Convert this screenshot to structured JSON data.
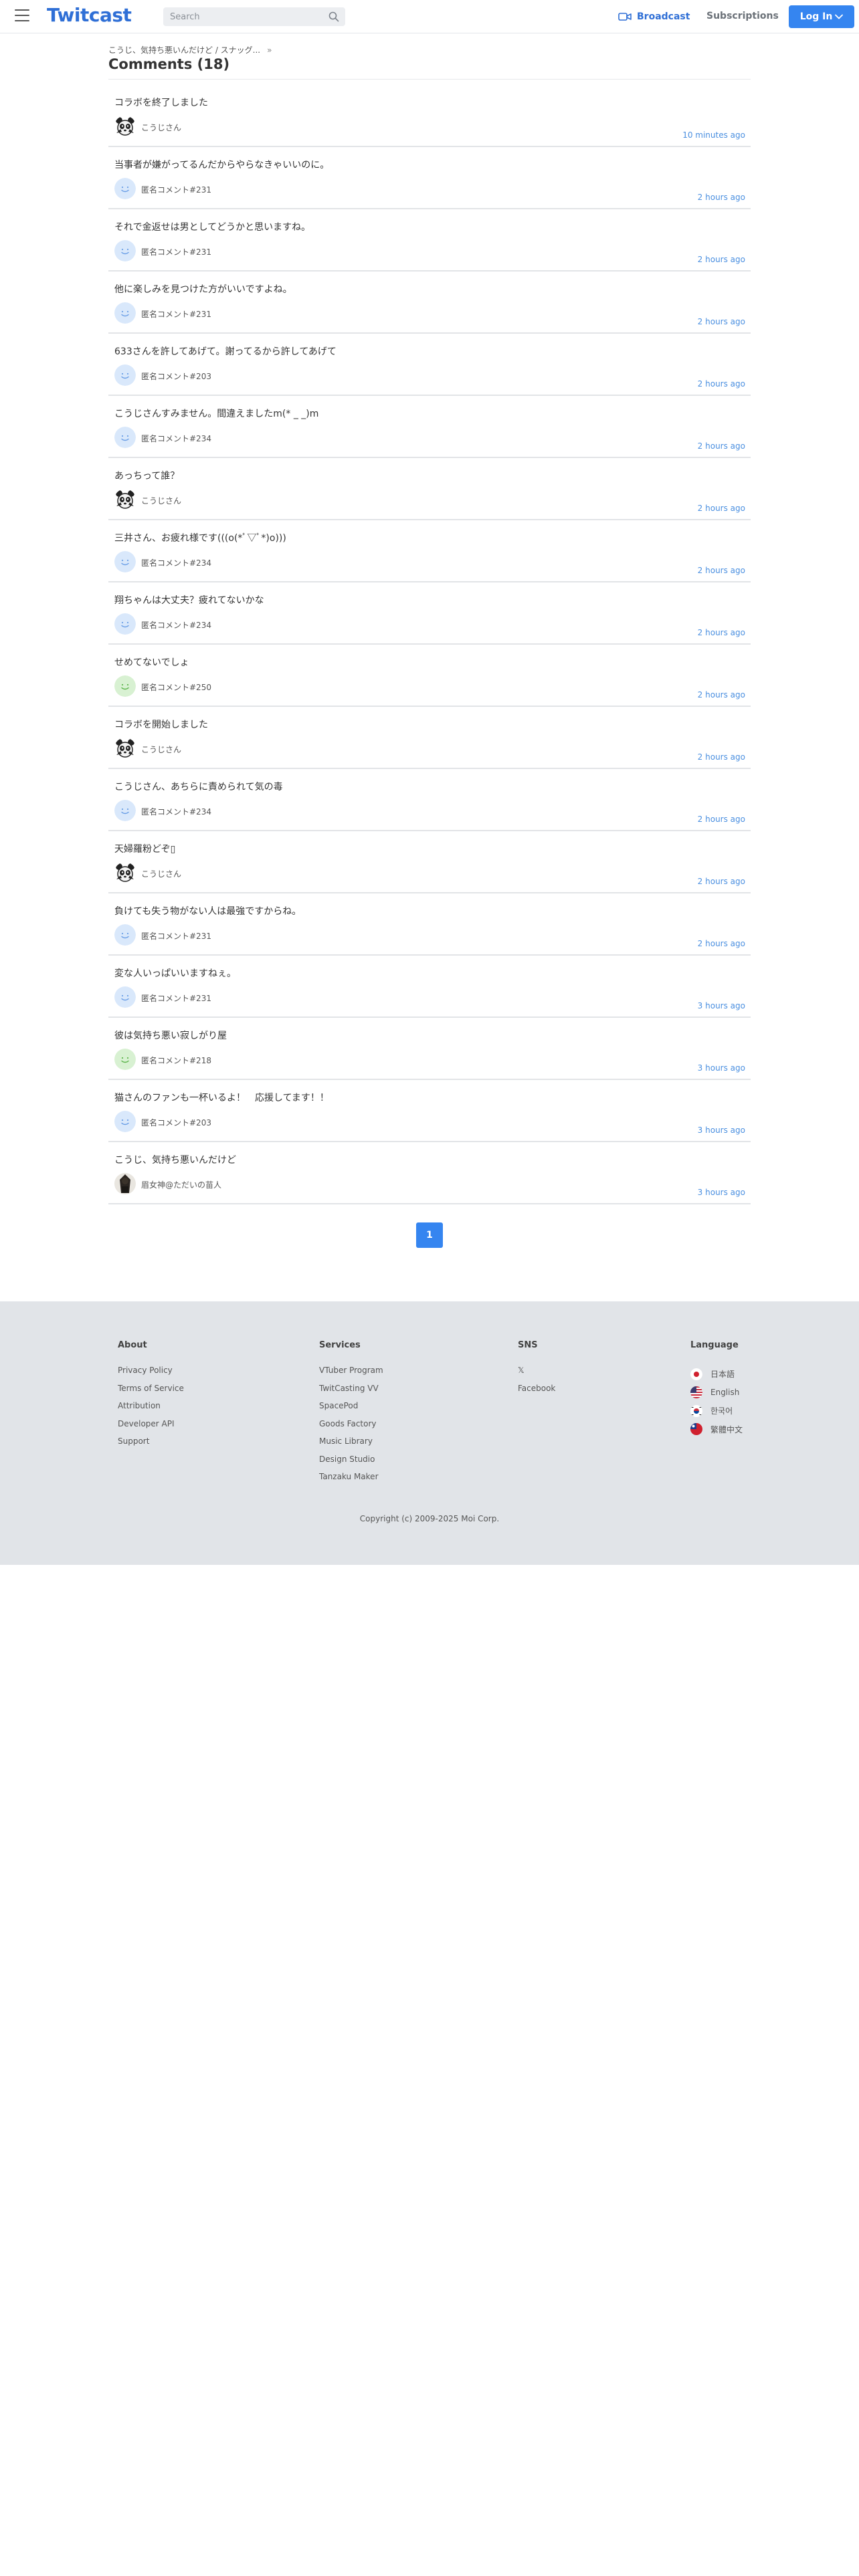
{
  "header": {
    "logo": "Twitcast",
    "search_placeholder": "Search",
    "broadcast_label": "Broadcast",
    "subscriptions_label": "Subscriptions",
    "login_label": "Log In"
  },
  "breadcrumb": {
    "text": "こうじ、気持ち悪いんだけど / スナッグ...",
    "chevron": "»"
  },
  "page": {
    "title": "Comments (18)"
  },
  "comments": [
    {
      "text": "コラボを終了しました",
      "author": "こうじさん",
      "avatar": "panda",
      "time": "10 minutes ago"
    },
    {
      "text": "当事者が嫌がってるんだからやらなきゃいいのに。",
      "author": "匿名コメント#231",
      "avatar": "blue-smile",
      "time": "2 hours ago"
    },
    {
      "text": "それで金返せは男としてどうかと思いますね。",
      "author": "匿名コメント#231",
      "avatar": "blue-smile",
      "time": "2 hours ago"
    },
    {
      "text": "他に楽しみを見つけた方がいいですよね。",
      "author": "匿名コメント#231",
      "avatar": "blue-smile",
      "time": "2 hours ago"
    },
    {
      "text": "633さんを許してあげて。謝ってるから許してあげて",
      "author": "匿名コメント#203",
      "avatar": "blue-smile",
      "time": "2 hours ago"
    },
    {
      "text": "こうじさんすみません。間違えましたm(* _ _)m",
      "author": "匿名コメント#234",
      "avatar": "blue-smile",
      "time": "2 hours ago"
    },
    {
      "text": "あっちって誰？",
      "author": "こうじさん",
      "avatar": "panda",
      "time": "2 hours ago"
    },
    {
      "text": "三井さん、お疲れ様です(((o(*ﾟ▽ﾟ*)o)))",
      "author": "匿名コメント#234",
      "avatar": "blue-smile",
      "time": "2 hours ago"
    },
    {
      "text": "翔ちゃんは大丈夫？疲れてないかな",
      "author": "匿名コメント#234",
      "avatar": "blue-smile",
      "time": "2 hours ago"
    },
    {
      "text": "せめてないでしょ",
      "author": "匿名コメント#250",
      "avatar": "green-smile",
      "time": "2 hours ago"
    },
    {
      "text": "コラボを開始しました",
      "author": "こうじさん",
      "avatar": "panda",
      "time": "2 hours ago"
    },
    {
      "text": "こうじさん、あちらに責められて気の毒",
      "author": "匿名コメント#234",
      "avatar": "blue-smile",
      "time": "2 hours ago"
    },
    {
      "text": "天婦羅粉どぞ▯",
      "author": "こうじさん",
      "avatar": "panda",
      "time": "2 hours ago"
    },
    {
      "text": "負けても失う物がない人は最強ですからね。",
      "author": "匿名コメント#231",
      "avatar": "blue-smile",
      "time": "2 hours ago"
    },
    {
      "text": "変な人いっぱいいますねぇ。",
      "author": "匿名コメント#231",
      "avatar": "blue-smile",
      "time": "3 hours ago"
    },
    {
      "text": "彼は気持ち悪い寂しがり屋",
      "author": "匿名コメント#218",
      "avatar": "green-smile",
      "time": "3 hours ago"
    },
    {
      "text": "猫さんのファンも一杯いるよ！　応援してます！！",
      "author": "匿名コメント#203",
      "avatar": "blue-smile",
      "time": "3 hours ago"
    },
    {
      "text": "こうじ、気持ち悪いんだけど",
      "author": "眉女神@ただいの苗人",
      "avatar": "photo",
      "time": "3 hours ago"
    }
  ],
  "pagination": {
    "current": "1"
  },
  "footer": {
    "about": {
      "heading": "About",
      "links": [
        "Privacy Policy",
        "Terms of Service",
        "Attribution",
        "Developer API",
        "Support"
      ]
    },
    "services": {
      "heading": "Services",
      "links": [
        "VTuber Program",
        "TwitCasting VV",
        "SpacePod",
        "Goods Factory",
        "Music Library",
        "Design Studio",
        "Tanzaku Maker"
      ]
    },
    "sns": {
      "heading": "SNS",
      "links": [
        "𝕏",
        "Facebook"
      ]
    },
    "language": {
      "heading": "Language",
      "items": [
        {
          "label": "日本語",
          "flag": "jp-flag"
        },
        {
          "label": "English",
          "flag": "us-flag"
        },
        {
          "label": "한국어",
          "flag": "kr-flag"
        },
        {
          "label": "繁體中文",
          "flag": "tw-flag"
        }
      ]
    },
    "copyright": "Copyright (c) 2009-2025 Moi Corp."
  },
  "colors": {
    "brand": "#2f6fd6",
    "accent": "#3585f0",
    "time": "#4a8fe0",
    "footer_bg": "#e1e4e8"
  }
}
